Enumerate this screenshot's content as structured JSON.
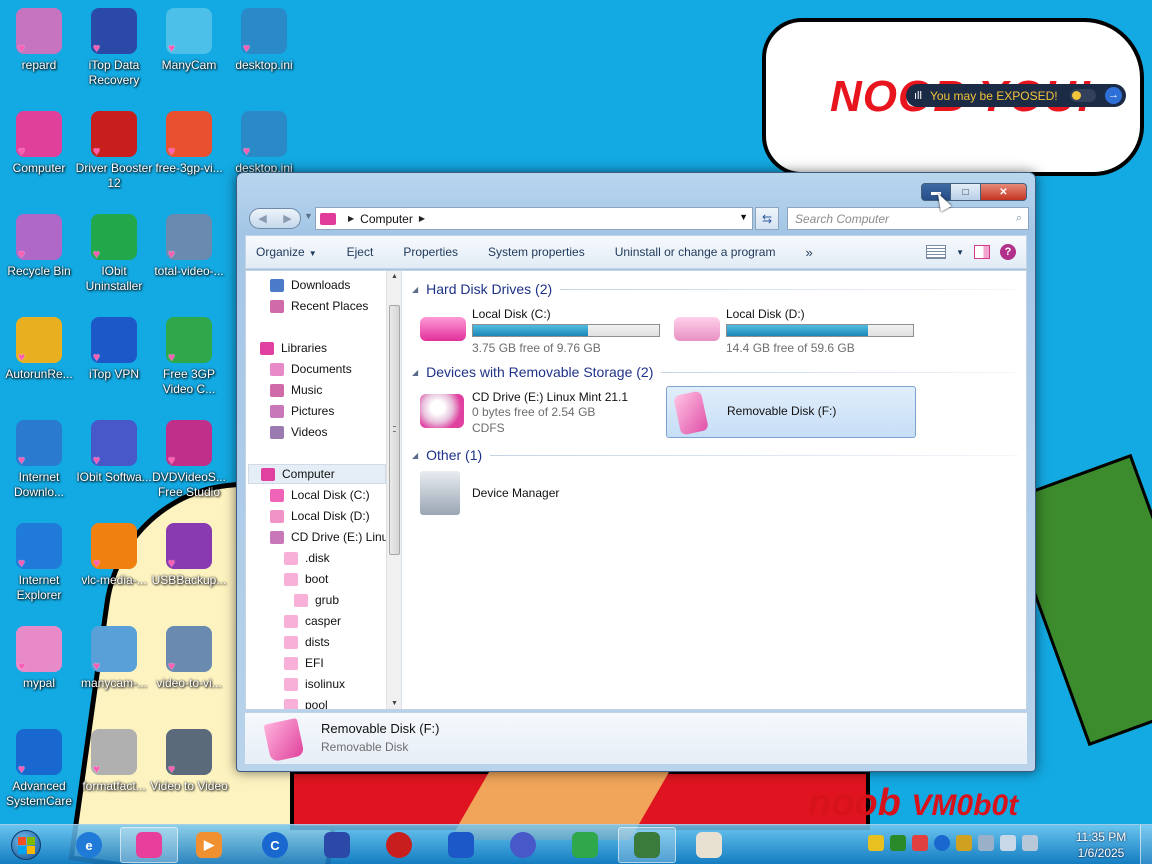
{
  "desktop": {
    "icons": [
      {
        "label": "repard",
        "icon": "folder-icon",
        "color": "#c774c0"
      },
      {
        "label": "iTop Data Recovery",
        "icon": "itop-recovery-icon",
        "color": "#2b4aa8"
      },
      {
        "label": "ManyCam",
        "icon": "manycam-icon",
        "color": "#4cc0e8"
      },
      {
        "label": "desktop.ini",
        "icon": "settings-file-icon",
        "color": "#2a8ac8"
      },
      {
        "label": "Computer",
        "icon": "computer-icon",
        "color": "#e0409a"
      },
      {
        "label": "Driver Booster 12",
        "icon": "driver-booster-icon",
        "color": "#c81e1e"
      },
      {
        "label": "free-3gp-vi...",
        "icon": "video-app-icon",
        "color": "#e85030"
      },
      {
        "label": "desktop.ini",
        "icon": "settings-file-icon",
        "color": "#2a8ac8"
      },
      {
        "label": "Recycle Bin",
        "icon": "recycle-bin-icon",
        "color": "#b068c8"
      },
      {
        "label": "IObit Uninstaller",
        "icon": "iobit-uninstaller-icon",
        "color": "#22a84a"
      },
      {
        "label": "total-video-...",
        "icon": "installer-icon",
        "color": "#6a8ab0"
      },
      {
        "label": "AutorunRe...",
        "icon": "usb-shield-icon",
        "color": "#e8b020"
      },
      {
        "label": "iTop VPN",
        "icon": "vpn-icon",
        "color": "#1d58c8"
      },
      {
        "label": "Free 3GP Video C...",
        "icon": "3gp-converter-icon",
        "color": "#2ea84a"
      },
      {
        "label": "Internet Downlo...",
        "icon": "idm-icon",
        "color": "#2a7ad0"
      },
      {
        "label": "IObit Softwa...",
        "icon": "iobit-software-icon",
        "color": "#4858c8"
      },
      {
        "label": "DVDVideoS... Free Studio",
        "icon": "fs-icon",
        "color": "#c0308a"
      },
      {
        "label": "Internet Explorer",
        "icon": "internet-explorer-icon",
        "color": "#1f7ad8"
      },
      {
        "label": "vlc-media-...",
        "icon": "vlc-icon",
        "color": "#f08010"
      },
      {
        "label": "USBBackup...",
        "icon": "winrar-icon",
        "color": "#8a3ab0"
      },
      {
        "label": "mypal",
        "icon": "folder-icon",
        "color": "#e88ac8"
      },
      {
        "label": "manycam-...",
        "icon": "installer-icon",
        "color": "#5aa0d8"
      },
      {
        "label": "video-to-vi...",
        "icon": "installer-icon",
        "color": "#6a8ab0"
      },
      {
        "label": "Advanced SystemCare",
        "icon": "advanced-systemcare-icon",
        "color": "#1868d0"
      },
      {
        "label": "formatfact...",
        "icon": "format-factory-icon",
        "color": "#b0b0b0"
      },
      {
        "label": "Video to Video",
        "icon": "film-reel-icon",
        "color": "#5a6a7a"
      }
    ],
    "noob_exposed": "NOOB YOU!",
    "noob_bottom": "noob",
    "noob_bottom_small": "VM0b0t"
  },
  "notification": {
    "text": "You may be EXPOSED!"
  },
  "explorer": {
    "address_crumb": "Computer",
    "search_placeholder": "Search Computer",
    "toolbar": {
      "organize": "Organize",
      "eject": "Eject",
      "properties": "Properties",
      "system_properties": "System properties",
      "uninstall": "Uninstall or change a program",
      "more": "»"
    },
    "nav_items": [
      {
        "label": "Downloads",
        "icon": "downloads-icon",
        "color": "#4a7ac8"
      },
      {
        "label": "Recent Places",
        "icon": "recent-places-icon",
        "color": "#d06aa8"
      },
      {
        "label": "Libraries",
        "icon": "libraries-icon",
        "color": "#e040a0"
      },
      {
        "label": "Documents",
        "icon": "documents-icon",
        "color": "#e88ac8"
      },
      {
        "label": "Music",
        "icon": "music-icon",
        "color": "#d06aa8"
      },
      {
        "label": "Pictures",
        "icon": "pictures-icon",
        "color": "#c878b8"
      },
      {
        "label": "Videos",
        "icon": "videos-icon",
        "color": "#9a7ab0"
      },
      {
        "label": "Computer",
        "icon": "computer-icon",
        "color": "#e040a0"
      },
      {
        "label": "Local Disk (C:)",
        "icon": "drive-icon",
        "color": "#f064b8"
      },
      {
        "label": "Local Disk (D:)",
        "icon": "drive-icon",
        "color": "#f094c8"
      },
      {
        "label": "CD Drive (E:) Linux Mint 21.1",
        "icon": "cd-drive-icon",
        "color": "#c878b8"
      },
      {
        "label": ".disk",
        "icon": "folder-icon",
        "color": "#f8b0d8"
      },
      {
        "label": "boot",
        "icon": "folder-icon",
        "color": "#f8b0d8"
      },
      {
        "label": "grub",
        "icon": "folder-icon",
        "color": "#f8b0d8"
      },
      {
        "label": "casper",
        "icon": "folder-icon",
        "color": "#f8b0d8"
      },
      {
        "label": "dists",
        "icon": "folder-icon",
        "color": "#f8b0d8"
      },
      {
        "label": "EFI",
        "icon": "folder-icon",
        "color": "#f8b0d8"
      },
      {
        "label": "isolinux",
        "icon": "folder-icon",
        "color": "#f8b0d8"
      },
      {
        "label": "pool",
        "icon": "folder-icon",
        "color": "#f8b0d8"
      }
    ],
    "groups": {
      "hdd": "Hard Disk Drives (2)",
      "removable": "Devices with Removable Storage (2)",
      "other": "Other (1)"
    },
    "drives": {
      "c": {
        "name": "Local Disk (C:)",
        "free": "3.75 GB free of 9.76 GB",
        "used_fraction": 0.62
      },
      "d": {
        "name": "Local Disk (D:)",
        "free": "14.4 GB free of 59.6 GB",
        "used_fraction": 0.76
      },
      "e": {
        "name": "CD Drive (E:) Linux Mint 21.1",
        "free": "0 bytes free of 2.54 GB",
        "fs": "CDFS"
      },
      "f": {
        "name": "Removable Disk (F:)"
      },
      "devmgr": {
        "name": "Device Manager"
      }
    },
    "details": {
      "name": "Removable Disk (F:)",
      "type": "Removable Disk"
    }
  },
  "taskbar": {
    "time": "11:35 PM",
    "date": "1/6/2025"
  }
}
